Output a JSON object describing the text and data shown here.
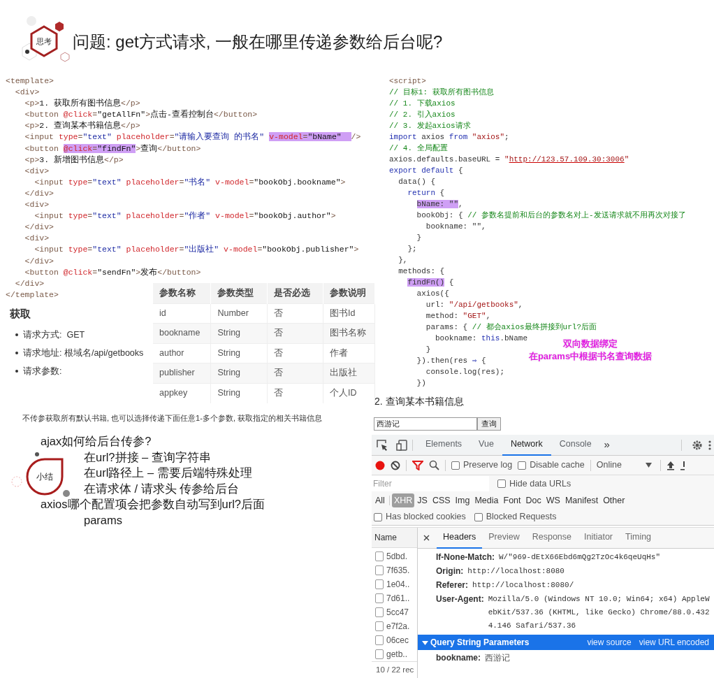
{
  "header": {
    "badge": "思考",
    "title": "问题: get方式请求, 一般在哪里传递参数给后台呢?"
  },
  "template_code": [
    {
      "tokens": [
        {
          "kind": "tag",
          "text": "<template>"
        }
      ],
      "children": [
        {
          "tokens": [
            {
              "kind": "tag",
              "text": "<div>"
            }
          ],
          "children": [
            {
              "tokens": [
                {
                  "kind": "tag",
                  "text": "<p>"
                },
                {
                  "kind": "text",
                  "text": "1. 获取所有图书信息"
                },
                {
                  "kind": "tag",
                  "text": "</p>"
                }
              ]
            },
            {
              "tokens": [
                {
                  "kind": "tag",
                  "text": "<button "
                },
                {
                  "kind": "attr",
                  "text": "@click"
                },
                {
                  "kind": "tag",
                  "text": "="
                },
                {
                  "kind": "text",
                  "text": "\"getAllFn\""
                },
                {
                  "kind": "tag",
                  "text": ">"
                },
                {
                  "kind": "text",
                  "text": "点击-查看控制台"
                },
                {
                  "kind": "tag",
                  "text": "</button>"
                }
              ]
            },
            {
              "tokens": [
                {
                  "kind": "tag",
                  "text": "<p>"
                },
                {
                  "kind": "text",
                  "text": "2. 查询某本书籍信息"
                },
                {
                  "kind": "tag",
                  "text": "</p>"
                }
              ]
            },
            {
              "tokens": [
                {
                  "kind": "tag",
                  "text": "<input "
                },
                {
                  "kind": "attr",
                  "text": "type"
                },
                {
                  "kind": "tag",
                  "text": "="
                },
                {
                  "kind": "str",
                  "text": "\"text\" "
                },
                {
                  "kind": "attr",
                  "text": "placeholder"
                },
                {
                  "kind": "tag",
                  "text": "="
                },
                {
                  "kind": "str",
                  "text": "\"请输入要查询 的书名\" "
                },
                {
                  "kind": "highlight",
                  "children": [
                    {
                      "kind": "attr",
                      "text": "v-model"
                    },
                    {
                      "kind": "tag",
                      "text": "="
                    },
                    {
                      "kind": "text",
                      "text": "\"bName\"  "
                    }
                  ]
                },
                {
                  "kind": "tag",
                  "text": "/>"
                }
              ]
            },
            {
              "tokens": [
                {
                  "kind": "tag",
                  "text": "<button "
                },
                {
                  "kind": "highlight",
                  "children": [
                    {
                      "kind": "attr",
                      "text": "@click"
                    },
                    {
                      "kind": "tag",
                      "text": "="
                    },
                    {
                      "kind": "text",
                      "text": "\"findFn\""
                    }
                  ]
                },
                {
                  "kind": "tag",
                  "text": ">"
                },
                {
                  "kind": "text",
                  "text": "查询"
                },
                {
                  "kind": "tag",
                  "text": "</button>"
                }
              ]
            },
            {
              "tokens": [
                {
                  "kind": "tag",
                  "text": "<p>"
                },
                {
                  "kind": "text",
                  "text": "3. 新增图书信息"
                },
                {
                  "kind": "tag",
                  "text": "</p>"
                }
              ]
            },
            {
              "tokens": [
                {
                  "kind": "tag",
                  "text": "<div>"
                }
              ],
              "children": [
                {
                  "tokens": [
                    {
                      "kind": "tag",
                      "text": "<input "
                    },
                    {
                      "kind": "attr",
                      "text": "type"
                    },
                    {
                      "kind": "tag",
                      "text": "="
                    },
                    {
                      "kind": "str",
                      "text": "\"text\" "
                    },
                    {
                      "kind": "attr",
                      "text": "placeholder"
                    },
                    {
                      "kind": "tag",
                      "text": "="
                    },
                    {
                      "kind": "str",
                      "text": "\"书名\" "
                    },
                    {
                      "kind": "attr",
                      "text": "v-model"
                    },
                    {
                      "kind": "tag",
                      "text": "="
                    },
                    {
                      "kind": "text",
                      "text": "\"bookObj.bookname\""
                    },
                    {
                      "kind": "tag",
                      "text": ">"
                    }
                  ]
                }
              ]
            },
            {
              "tokens": [
                {
                  "kind": "tag",
                  "text": "</div>"
                }
              ]
            },
            {
              "tokens": [
                {
                  "kind": "tag",
                  "text": "<div>"
                }
              ],
              "children": [
                {
                  "tokens": [
                    {
                      "kind": "tag",
                      "text": "<input "
                    },
                    {
                      "kind": "attr",
                      "text": "type"
                    },
                    {
                      "kind": "tag",
                      "text": "="
                    },
                    {
                      "kind": "str",
                      "text": "\"text\" "
                    },
                    {
                      "kind": "attr",
                      "text": "placeholder"
                    },
                    {
                      "kind": "tag",
                      "text": "="
                    },
                    {
                      "kind": "str",
                      "text": "\"作者\" "
                    },
                    {
                      "kind": "attr",
                      "text": "v-model"
                    },
                    {
                      "kind": "tag",
                      "text": "="
                    },
                    {
                      "kind": "text",
                      "text": "\"bookObj.author\""
                    },
                    {
                      "kind": "tag",
                      "text": ">"
                    }
                  ]
                }
              ]
            },
            {
              "tokens": [
                {
                  "kind": "tag",
                  "text": "</div>"
                }
              ]
            },
            {
              "tokens": [
                {
                  "kind": "tag",
                  "text": "<div>"
                }
              ],
              "children": [
                {
                  "tokens": [
                    {
                      "kind": "tag",
                      "text": "<input "
                    },
                    {
                      "kind": "attr",
                      "text": "type"
                    },
                    {
                      "kind": "tag",
                      "text": "="
                    },
                    {
                      "kind": "str",
                      "text": "\"text\" "
                    },
                    {
                      "kind": "attr",
                      "text": "placeholder"
                    },
                    {
                      "kind": "tag",
                      "text": "="
                    },
                    {
                      "kind": "str",
                      "text": "\"出版社\" "
                    },
                    {
                      "kind": "attr",
                      "text": "v-model"
                    },
                    {
                      "kind": "tag",
                      "text": "="
                    },
                    {
                      "kind": "text",
                      "text": "\"bookObj.publisher\""
                    },
                    {
                      "kind": "tag",
                      "text": ">"
                    }
                  ]
                }
              ]
            },
            {
              "tokens": [
                {
                  "kind": "tag",
                  "text": "</div>"
                }
              ]
            },
            {
              "tokens": [
                {
                  "kind": "tag",
                  "text": "<button "
                },
                {
                  "kind": "attr",
                  "text": "@click"
                },
                {
                  "kind": "tag",
                  "text": "="
                },
                {
                  "kind": "text",
                  "text": "\"sendFn\""
                },
                {
                  "kind": "tag",
                  "text": ">"
                },
                {
                  "kind": "text",
                  "text": "发布"
                },
                {
                  "kind": "tag",
                  "text": "</button>"
                }
              ]
            }
          ]
        },
        {
          "tokens": [
            {
              "kind": "tag",
              "text": "</div>"
            }
          ]
        }
      ]
    },
    {
      "tokens": [
        {
          "kind": "tag",
          "text": "</template>"
        }
      ]
    }
  ],
  "script_code": [
    {
      "tokens": [
        {
          "kind": "tag",
          "text": "<script>"
        }
      ]
    },
    {
      "tokens": [
        {
          "kind": "comment",
          "text": "// 目标1: 获取所有图书信息"
        }
      ]
    },
    {
      "tokens": [
        {
          "kind": "comment",
          "text": "// 1. 下载axios"
        }
      ]
    },
    {
      "tokens": [
        {
          "kind": "comment",
          "text": "// 2. 引入axios"
        }
      ]
    },
    {
      "tokens": [
        {
          "kind": "comment",
          "text": "// 3. 发起axios请求"
        }
      ]
    },
    {
      "tokens": [
        {
          "kind": "keyword",
          "text": "import"
        },
        {
          "kind": "plain",
          "text": " axios "
        },
        {
          "kind": "keyword",
          "text": "from"
        },
        {
          "kind": "string",
          "text": " \"axios\""
        },
        {
          "kind": "plain",
          "text": ";"
        }
      ]
    },
    {
      "tokens": [
        {
          "kind": "comment",
          "text": "// 4. 全局配置"
        }
      ]
    },
    {
      "tokens": [
        {
          "kind": "plain",
          "text": "axios.defaults.baseURL = "
        },
        {
          "kind": "string",
          "text": "\""
        },
        {
          "kind": "url",
          "text": "http://123.57.109.30:3006"
        },
        {
          "kind": "string",
          "text": "\""
        }
      ]
    },
    {
      "tokens": [
        {
          "kind": "keyword",
          "text": "export default"
        },
        {
          "kind": "plain",
          "text": " {"
        }
      ],
      "children": [
        {
          "tokens": [
            {
              "kind": "plain",
              "text": "data() {"
            }
          ],
          "children": [
            {
              "tokens": [
                {
                  "kind": "keyword",
                  "text": "return"
                },
                {
                  "kind": "plain",
                  "text": " {"
                }
              ],
              "children": [
                {
                  "tokens": [
                    {
                      "kind": "highlight",
                      "children": [
                        {
                          "kind": "plain",
                          "text": "bName: \"\""
                        }
                      ]
                    },
                    {
                      "kind": "plain",
                      "text": ","
                    }
                  ]
                },
                {
                  "tokens": [
                    {
                      "kind": "plain",
                      "text": "bookObj: { "
                    },
                    {
                      "kind": "comment",
                      "text": "// 参数名提前和后台的参数名对上-发送请求就不用再次对接了"
                    }
                  ],
                  "children": [
                    {
                      "tokens": [
                        {
                          "kind": "plain",
                          "text": "bookname: \"\","
                        }
                      ]
                    }
                  ]
                },
                {
                  "tokens": [
                    {
                      "kind": "plain",
                      "text": "}"
                    }
                  ]
                }
              ]
            },
            {
              "tokens": [
                {
                  "kind": "plain",
                  "text": "};"
                }
              ]
            }
          ]
        },
        {
          "tokens": [
            {
              "kind": "plain",
              "text": "},"
            }
          ]
        },
        {
          "tokens": [
            {
              "kind": "plain",
              "text": "methods: {"
            }
          ],
          "children": [
            {
              "tokens": [
                {
                  "kind": "highlight",
                  "children": [
                    {
                      "kind": "plain",
                      "text": "findFn()"
                    }
                  ]
                },
                {
                  "kind": "plain",
                  "text": " {"
                }
              ],
              "children": [
                {
                  "tokens": [
                    {
                      "kind": "plain",
                      "text": "axios({"
                    }
                  ],
                  "children": [
                    {
                      "tokens": [
                        {
                          "kind": "plain",
                          "text": "url: "
                        },
                        {
                          "kind": "string",
                          "text": "\"/api/getbooks\""
                        },
                        {
                          "kind": "plain",
                          "text": ","
                        }
                      ]
                    },
                    {
                      "tokens": [
                        {
                          "kind": "plain",
                          "text": "method: "
                        },
                        {
                          "kind": "string",
                          "text": "\"GET\""
                        },
                        {
                          "kind": "plain",
                          "text": ","
                        }
                      ]
                    },
                    {
                      "tokens": [
                        {
                          "kind": "plain",
                          "text": "params: { "
                        },
                        {
                          "kind": "comment",
                          "text": "// 都会axios最终拼接到url?后面"
                        }
                      ],
                      "children": [
                        {
                          "tokens": [
                            {
                              "kind": "plain",
                              "text": "bookname: "
                            },
                            {
                              "kind": "keyword",
                              "text": "this"
                            },
                            {
                              "kind": "plain",
                              "text": ".bName"
                            }
                          ]
                        }
                      ]
                    },
                    {
                      "tokens": [
                        {
                          "kind": "plain",
                          "text": "}"
                        }
                      ]
                    }
                  ]
                },
                {
                  "tokens": [
                    {
                      "kind": "plain",
                      "text": "}).then(res "
                    },
                    {
                      "kind": "keyword",
                      "text": "⇒"
                    },
                    {
                      "kind": "plain",
                      "text": " {"
                    }
                  ],
                  "children": [
                    {
                      "tokens": [
                        {
                          "kind": "plain",
                          "text": "console.log(res);"
                        }
                      ]
                    }
                  ]
                },
                {
                  "tokens": [
                    {
                      "kind": "plain",
                      "text": "})"
                    }
                  ]
                }
              ]
            }
          ]
        }
      ]
    }
  ],
  "annotation": [
    "双向数据绑定",
    "在params中根据书名查询数据"
  ],
  "api_doc": {
    "heading": "获取",
    "bullets": [
      "请求方式:  GET",
      "请求地址: 根域名/api/getbooks",
      "请求参数:"
    ],
    "table": {
      "columns": [
        "参数名称",
        "参数类型",
        "是否必选",
        "参数说明"
      ],
      "rows": [
        [
          "id",
          "Number",
          "否",
          "图书Id"
        ],
        [
          "bookname",
          "String",
          "否",
          "图书名称"
        ],
        [
          "author",
          "String",
          "否",
          "作者"
        ],
        [
          "publisher",
          "String",
          "否",
          "出版社"
        ],
        [
          "appkey",
          "String",
          "否",
          "个人ID"
        ]
      ]
    },
    "note": "不传参获取所有默认书籍, 也可以选择传递下面任意1-多个参数, 获取指定的相关书籍信息"
  },
  "summary": {
    "badge": "小结",
    "lines": [
      {
        "kind": "question",
        "text": "ajax如何给后台传参?"
      },
      {
        "kind": "answer",
        "text": "在url?拼接 – 查询字符串"
      },
      {
        "kind": "answer",
        "text": "在url路径上 – 需要后端特殊处理"
      },
      {
        "kind": "answer",
        "text": "在请求体 / 请求头 传参给后台"
      },
      {
        "kind": "question",
        "text": "axios哪个配置项会把参数自动写到url?后面"
      },
      {
        "kind": "answer",
        "text": "params"
      }
    ]
  },
  "demo": {
    "heading": "2. 查询某本书籍信息",
    "input_value": "西游记",
    "button": "查询"
  },
  "devtools": {
    "tabs": [
      {
        "label": "Elements",
        "selected": false
      },
      {
        "label": "Vue",
        "selected": false
      },
      {
        "label": "Network",
        "selected": true
      },
      {
        "label": "Console",
        "selected": false
      }
    ],
    "more_tabs": "»",
    "recording": true,
    "options": [
      {
        "label": "Preserve log",
        "checked": false
      },
      {
        "label": "Disable cache",
        "checked": false
      }
    ],
    "throttling": "Online",
    "filter": {
      "placeholder": "Filter"
    },
    "hide_data_urls": {
      "label": "Hide data URLs",
      "checked": false
    },
    "type_filters": [
      {
        "label": "All",
        "selected": false
      },
      {
        "label": "XHR",
        "selected": true
      },
      {
        "label": "JS",
        "selected": false
      },
      {
        "label": "CSS",
        "selected": false
      },
      {
        "label": "Img",
        "selected": false
      },
      {
        "label": "Media",
        "selected": false
      },
      {
        "label": "Font",
        "selected": false
      },
      {
        "label": "Doc",
        "selected": false
      },
      {
        "label": "WS",
        "selected": false
      },
      {
        "label": "Manifest",
        "selected": false
      },
      {
        "label": "Other",
        "selected": false
      }
    ],
    "blocked_filters": [
      {
        "label": "Has blocked cookies",
        "checked": false
      },
      {
        "label": "Blocked Requests",
        "checked": false
      }
    ],
    "requests": {
      "column": "Name",
      "rows": [
        "5dbd.",
        "7f635.",
        "1e04..",
        "7d61..",
        "5cc47",
        "e7f2a.",
        "06cec",
        "getb.."
      ],
      "status": "10 / 22 rec"
    },
    "detail_tabs": [
      {
        "label": "Headers",
        "selected": true
      },
      {
        "label": "Preview",
        "selected": false
      },
      {
        "label": "Response",
        "selected": false
      },
      {
        "label": "Initiator",
        "selected": false
      },
      {
        "label": "Timing",
        "selected": false
      }
    ],
    "headers": [
      {
        "name": "If-None-Match:",
        "value": "W/\"969-dEtX66Ebd6mQg2TzOc4k6qeUqHs\""
      },
      {
        "name": "Origin:",
        "value": "http://localhost:8080"
      },
      {
        "name": "Referer:",
        "value": "http://localhost:8080/"
      },
      {
        "name": "User-Agent:",
        "value": "Mozilla/5.0 (Windows NT 10.0; Win64; x64) AppleWebKit/537.36 (KHTML, like Gecko) Chrome/88.0.4324.146 Safari/537.36"
      }
    ],
    "query_section": {
      "title": "Query String Parameters",
      "expanded": true,
      "links": [
        "view source",
        "view URL encoded"
      ]
    },
    "query_params": [
      {
        "name": "bookname:",
        "value": "西游记"
      }
    ]
  }
}
